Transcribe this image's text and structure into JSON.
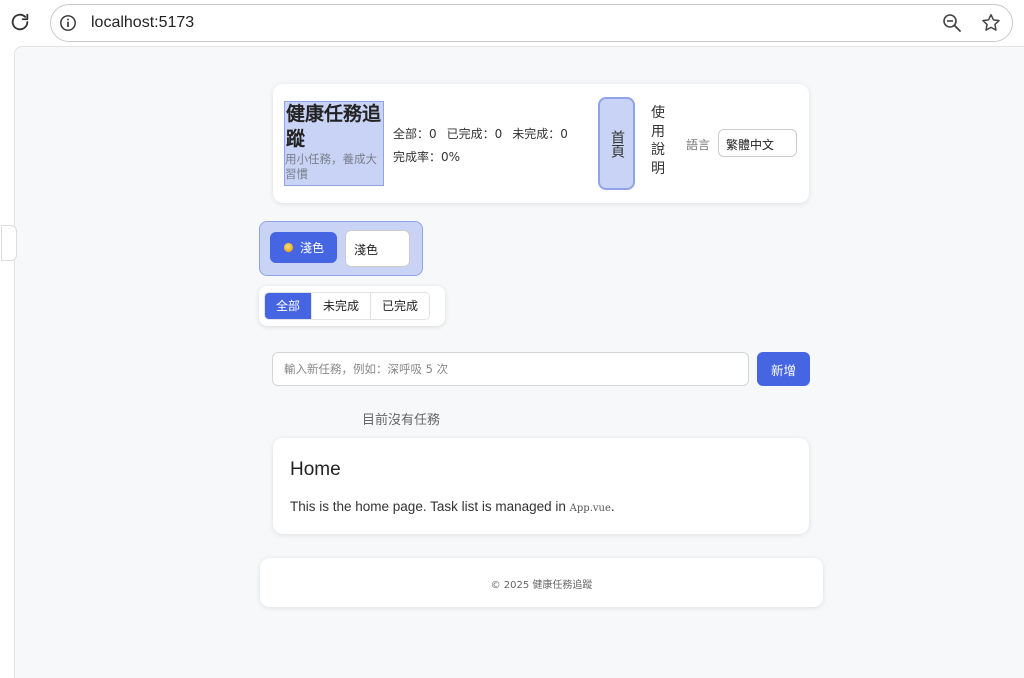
{
  "browser": {
    "url": "localhost:5173"
  },
  "header": {
    "title": "健康任務追蹤",
    "subtitle": "用小任務，養成大習慣",
    "stats": {
      "all": "全部：0",
      "done": "已完成：0",
      "undone": "未完成：0",
      "rate": "完成率：0%"
    },
    "nav": {
      "home": "首頁",
      "help": "使用說明"
    },
    "language": {
      "label": "語言",
      "selected": "繁體中文"
    }
  },
  "theme": {
    "button_label": "淺色",
    "select_value": "淺色"
  },
  "filters": {
    "tabs": [
      {
        "label": "全部",
        "active": true
      },
      {
        "label": "未完成",
        "active": false
      },
      {
        "label": "已完成",
        "active": false
      }
    ]
  },
  "task_form": {
    "placeholder": "輸入新任務，例如：深呼吸 5 次",
    "add_label": "新增"
  },
  "task_list": {
    "empty_message": "目前沒有任務"
  },
  "home": {
    "title": "Home",
    "text_before": "This is the home page. Task list is managed in",
    "code": "App.vue",
    "text_after": "."
  },
  "footer": {
    "text": "© 2025 健康任務追蹤"
  },
  "colors": {
    "accent": "#4565e3",
    "highlight": "#c8d3f5",
    "page_bg": "#f7f8fa"
  }
}
